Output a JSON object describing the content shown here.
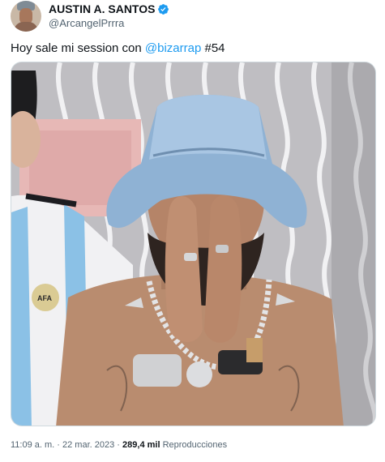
{
  "author": {
    "display_name": "AUSTIN A. SANTOS",
    "handle": "@ArcangelPrrra",
    "verified": true,
    "avatar_icon": "user-avatar"
  },
  "tweet": {
    "text_prefix": "Hoy sale mi session con ",
    "mention": "@bizarrap",
    "text_suffix": " #54"
  },
  "media": {
    "type": "photo"
  },
  "meta": {
    "time": "11:09 a. m.",
    "separator": "·",
    "date": "22 mar. 2023",
    "views_count": "289,4 mil",
    "views_label": "Reproducciones"
  },
  "colors": {
    "accent": "#1d9bf0",
    "text": "#0f1419",
    "muted": "#536471"
  }
}
